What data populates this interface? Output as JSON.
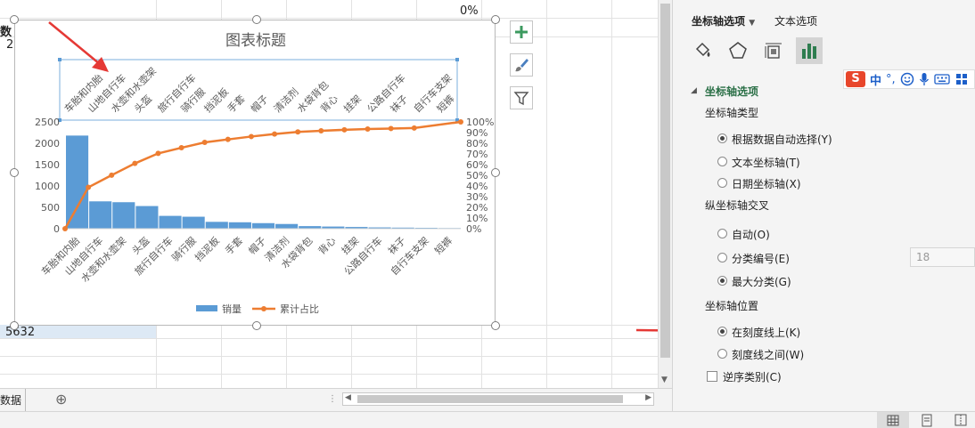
{
  "sheet": {
    "cell_header": "数",
    "cell_2": "2",
    "cell_total": "5632",
    "cell_percent": "0%",
    "tab_label": "数据",
    "add_sheet": "⊕"
  },
  "chart": {
    "title": "图表标题",
    "tools": [
      "+",
      "brush",
      "filter"
    ],
    "legend": [
      "销量",
      "累计占比"
    ],
    "colors": {
      "bar": "#5b9bd5",
      "line": "#ed7d31"
    }
  },
  "chart_data": {
    "type": "bar",
    "title": "图表标题",
    "categories": [
      "车胎和内胎",
      "山地自行车",
      "水壶和水壶架",
      "头盔",
      "旅行自行车",
      "骑行服",
      "挡泥板",
      "手套",
      "帽子",
      "清洁剂",
      "水袋背包",
      "背心",
      "挂架",
      "公路自行车",
      "袜子",
      "自行车支架",
      "短裤"
    ],
    "series": [
      {
        "name": "销量",
        "axis": "left",
        "values": [
          2180,
          640,
          620,
          530,
          300,
          280,
          160,
          150,
          130,
          110,
          60,
          50,
          40,
          30,
          25,
          20,
          15
        ]
      },
      {
        "name": "累计占比",
        "axis": "right",
        "type": "line",
        "values": [
          0,
          38.7,
          50.1,
          61.1,
          70.5,
          75.8,
          80.8,
          83.6,
          86.3,
          88.6,
          90.6,
          91.7,
          92.6,
          93.3,
          93.8,
          94.3,
          100
        ]
      }
    ],
    "ylim": [
      0,
      2500
    ],
    "yticks": [
      0,
      500,
      1000,
      1500,
      2000,
      2500
    ],
    "y2lim": [
      0,
      100
    ],
    "y2ticks": [
      "0%",
      "10%",
      "20%",
      "30%",
      "40%",
      "50%",
      "60%",
      "70%",
      "80%",
      "90%",
      "100%"
    ],
    "grid": false,
    "legend": "bottom"
  },
  "pane": {
    "tab_axis": "坐标轴选项",
    "tab_text": "文本选项",
    "section": "坐标轴选项",
    "axis_type_label": "坐标轴类型",
    "axis_type_options": [
      "根据数据自动选择(Y)",
      "文本坐标轴(T)",
      "日期坐标轴(X)"
    ],
    "cross_label": "纵坐标轴交叉",
    "cross_options": [
      "自动(O)",
      "分类编号(E)",
      "最大分类(G)"
    ],
    "cross_value": "18",
    "position_label": "坐标轴位置",
    "position_options": [
      "在刻度线上(K)",
      "刻度线之间(W)"
    ],
    "reverse_label": "逆序类别(C)",
    "ime_cn": "中"
  }
}
